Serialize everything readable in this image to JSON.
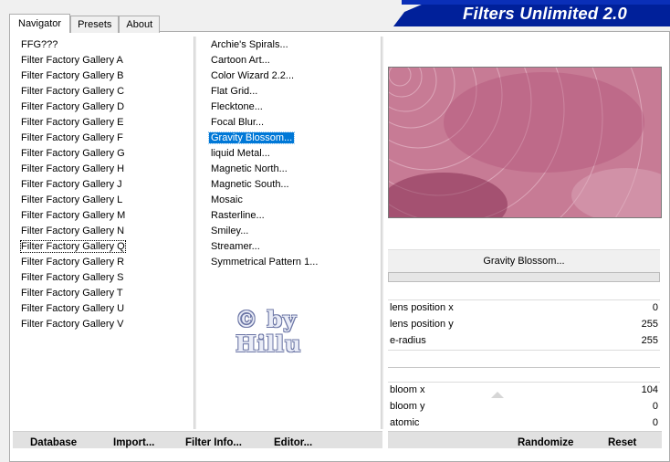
{
  "tabs": [
    "Navigator",
    "Presets",
    "About"
  ],
  "banner": {
    "title": "Filters Unlimited 2.0",
    "color": "#00209a"
  },
  "categories": {
    "items": [
      "FFG???",
      "Filter Factory Gallery A",
      "Filter Factory Gallery B",
      "Filter Factory Gallery C",
      "Filter Factory Gallery D",
      "Filter Factory Gallery E",
      "Filter Factory Gallery F",
      "Filter Factory Gallery G",
      "Filter Factory Gallery H",
      "Filter Factory Gallery J",
      "Filter Factory Gallery L",
      "Filter Factory Gallery M",
      "Filter Factory Gallery N",
      "Filter Factory Gallery Q",
      "Filter Factory Gallery R",
      "Filter Factory Gallery S",
      "Filter Factory Gallery T",
      "Filter Factory Gallery U",
      "Filter Factory Gallery V"
    ],
    "selected": "Filter Factory Gallery Q"
  },
  "filters": {
    "items": [
      "Archie's Spirals...",
      "Cartoon Art...",
      "Color Wizard 2.2...",
      "Flat Grid...",
      "Flecktone...",
      "Focal Blur...",
      "Gravity Blossom...",
      "liquid Metal...",
      "Magnetic North...",
      "Magnetic South...",
      "Mosaic",
      "Rasterline...",
      "Smiley...",
      "Streamer...",
      "Symmetrical Pattern 1..."
    ],
    "selected": "Gravity Blossom...",
    "selection_color": "#0078d7"
  },
  "watermark": {
    "line1": "© by",
    "line2": "Hillu"
  },
  "preview": {
    "filter_name": "Gravity Blossom...",
    "colors": [
      "#dba3b6",
      "#b55377",
      "#7a1f45"
    ]
  },
  "params": [
    {
      "name": "lens position x",
      "value": "0"
    },
    {
      "name": "lens position y",
      "value": "255"
    },
    {
      "name": "e-radius",
      "value": "255"
    },
    {
      "name": "bloom x",
      "value": "104"
    },
    {
      "name": "bloom y",
      "value": "0"
    },
    {
      "name": "atomic",
      "value": "0"
    }
  ],
  "buttons": {
    "database": "Database",
    "import": "Import...",
    "filter_info": "Filter Info...",
    "editor": "Editor...",
    "randomize": "Randomize",
    "reset": "Reset"
  }
}
